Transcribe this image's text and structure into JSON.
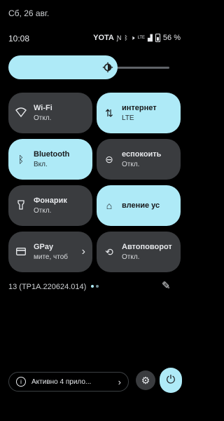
{
  "status": {
    "date": "Сб, 26 авг.",
    "time": "10:08",
    "carrier": "YOTA",
    "battery": "56 %",
    "lte": "LTE"
  },
  "brightness": {
    "level": 0.65,
    "icon": "brightness-icon"
  },
  "tiles": [
    {
      "title": "Wi-Fi",
      "sub": "Откл.",
      "state": "off",
      "icon": "wifi-icon"
    },
    {
      "title": "интернет",
      "sub": "LTE",
      "state": "on",
      "icon": "mobile-data-icon"
    },
    {
      "title": "Bluetooth",
      "sub": "Вкл.",
      "state": "on",
      "icon": "bluetooth-icon"
    },
    {
      "title": "еспокоить",
      "sub": "Откл.",
      "state": "off",
      "icon": "do-not-disturb-icon"
    },
    {
      "title": "Фонарик",
      "sub": "Откл.",
      "state": "off",
      "icon": "flashlight-icon"
    },
    {
      "title": "вление ус",
      "sub": "",
      "state": "on",
      "icon": "home-icon"
    },
    {
      "title": "GPay",
      "sub": "мите, чтоб",
      "state": "off",
      "icon": "card-icon"
    },
    {
      "title": "Автоповорот",
      "sub": "Откл.",
      "state": "off",
      "icon": "rotate-icon"
    }
  ],
  "build": "13 (TP1A.220624.014)",
  "footer": {
    "apps_label": "Активно 4 прило..."
  },
  "colors": {
    "accent": "#aeeaf7",
    "tile_off": "#3a3c3f",
    "background": "#000000"
  }
}
